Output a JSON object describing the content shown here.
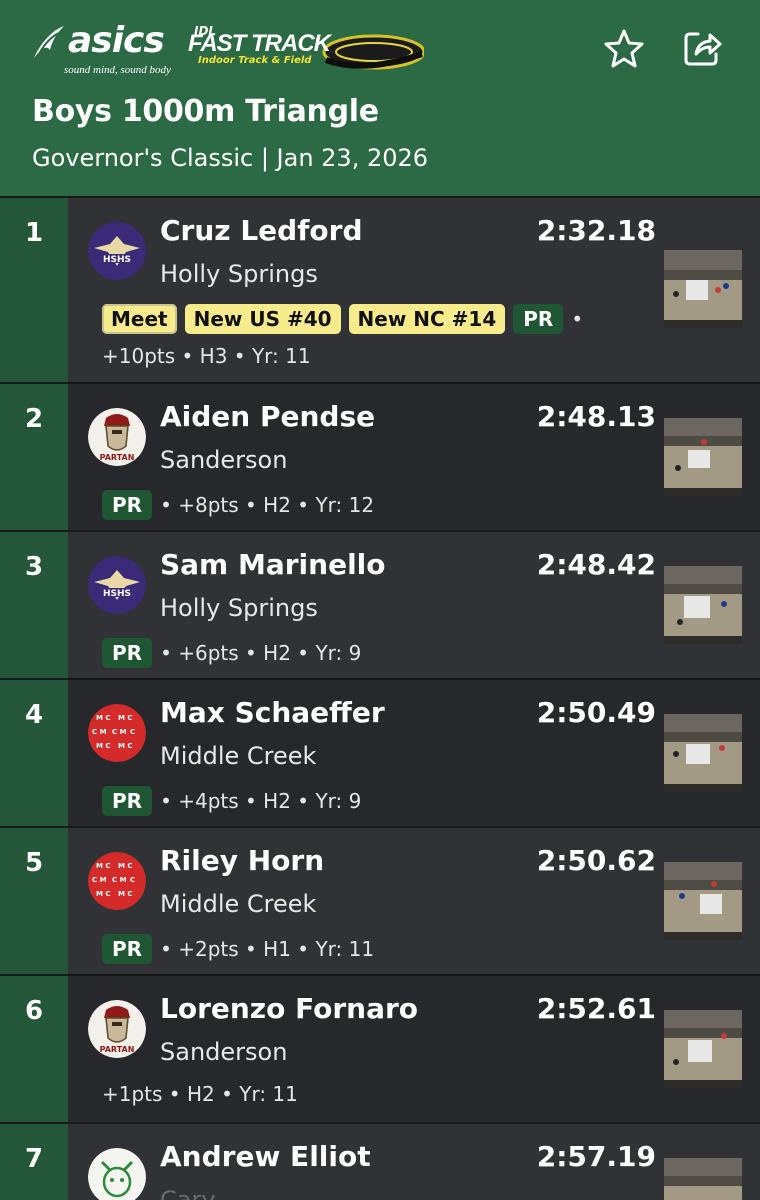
{
  "header": {
    "asics_word": "asics",
    "asics_tagline": "sound mind, sound body",
    "fasttrack_jdl": "JDL",
    "fasttrack_title": "FAST TRACK",
    "fasttrack_sub": "Indoor Track & Field",
    "title": "Boys 1000m Triangle",
    "subtitle": "Governor's Classic | Jan 23, 2026",
    "icons": [
      "star-icon",
      "share-icon"
    ]
  },
  "results": [
    {
      "place": "1",
      "name": "Cruz Ledford",
      "time": "2:32.18",
      "school": "Holly Springs",
      "logo": "hshs",
      "badges": [
        "Meet",
        "New US #40",
        "New NC #14"
      ],
      "pr": "PR",
      "meta_tail": "•",
      "meta2": "+10pts • H3 • Yr: 11"
    },
    {
      "place": "2",
      "name": "Aiden Pendse",
      "time": "2:48.13",
      "school": "Sanderson",
      "logo": "spartan",
      "pr": "PR",
      "meta": "• +8pts • H2 • Yr: 12"
    },
    {
      "place": "3",
      "name": "Sam Marinello",
      "time": "2:48.42",
      "school": "Holly Springs",
      "logo": "hshs",
      "pr": "PR",
      "meta": "• +6pts • H2 • Yr: 9"
    },
    {
      "place": "4",
      "name": "Max Schaeffer",
      "time": "2:50.49",
      "school": "Middle Creek",
      "logo": "middlecreek",
      "pr": "PR",
      "meta": "• +4pts • H2 • Yr: 9"
    },
    {
      "place": "5",
      "name": "Riley Horn",
      "time": "2:50.62",
      "school": "Middle Creek",
      "logo": "middlecreek",
      "pr": "PR",
      "meta": "• +2pts • H1 • Yr: 11"
    },
    {
      "place": "6",
      "name": "Lorenzo Fornaro",
      "time": "2:52.61",
      "school": "Sanderson",
      "logo": "spartan",
      "meta": "+1pts • H2 • Yr: 11"
    },
    {
      "place": "7",
      "name": "Andrew Elliot",
      "time": "2:57.19",
      "school": "Cary",
      "logo": "cary"
    }
  ],
  "colors": {
    "header_green": "#2b6a44",
    "place_green": "#24563a",
    "pr_badge": "#1f5634",
    "record_badge": "#f6ec8c",
    "row_dark": "#26282b",
    "row_light": "#303236"
  }
}
